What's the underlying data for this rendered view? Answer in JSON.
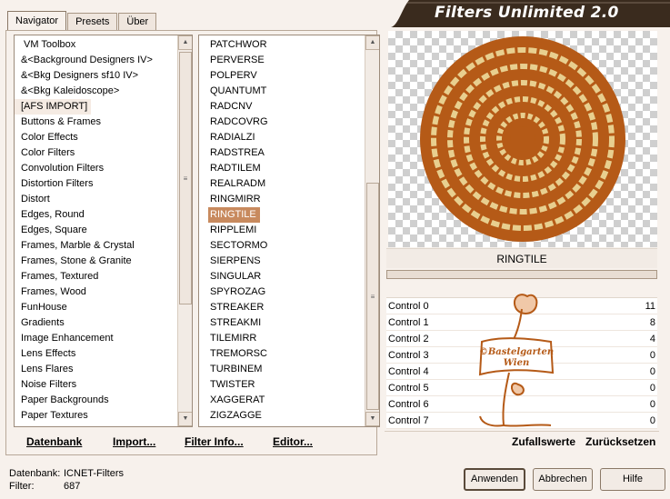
{
  "title": "Filters Unlimited 2.0",
  "tabs": [
    "Navigator",
    "Presets",
    "Über"
  ],
  "categories": [
    "VM Toolbox",
    "&<Background Designers IV>",
    "&<Bkg Designers sf10 IV>",
    "&<Bkg Kaleidoscope>",
    "[AFS IMPORT]",
    "Buttons & Frames",
    "Color Effects",
    "Color Filters",
    "Convolution Filters",
    "Distortion Filters",
    "Distort",
    "Edges, Round",
    "Edges, Square",
    "Frames, Marble & Crystal",
    "Frames, Stone & Granite",
    "Frames, Textured",
    "Frames, Wood",
    "FunHouse",
    "Gradients",
    "Image Enhancement",
    "Lens Effects",
    "Lens Flares",
    "Noise Filters",
    "Paper Backgrounds",
    "Paper Textures"
  ],
  "filters": [
    "PATCHWOR",
    "PERVERSE",
    "POLPERV",
    "QUANTUMT",
    "RADCNV",
    "RADCOVRG",
    "RADIALZI",
    "RADSTREA",
    "RADTILEM",
    "REALRADM",
    "RINGMIRR",
    "RINGTILE",
    "RIPPLEMI",
    "SECTORMO",
    "SIERPENS",
    "SINGULAR",
    "SPYROZAG",
    "STREAKER",
    "STREAKMI",
    "TILEMIRR",
    "TREMORSC",
    "TURBINEM",
    "TWISTER",
    "XAGGERAT",
    "ZIGZAGGE"
  ],
  "selected_category": "[AFS IMPORT]",
  "selected_filter": "RINGTILE",
  "left_buttons": {
    "datenbank": "Datenbank",
    "import": "Import...",
    "filter_info": "Filter Info...",
    "editor": "Editor..."
  },
  "filter_name": "RINGTILE",
  "controls": [
    {
      "label": "Control 0",
      "value": "11"
    },
    {
      "label": "Control 1",
      "value": "8"
    },
    {
      "label": "Control 2",
      "value": "4"
    },
    {
      "label": "Control 3",
      "value": "0"
    },
    {
      "label": "Control 4",
      "value": "0"
    },
    {
      "label": "Control 5",
      "value": "0"
    },
    {
      "label": "Control 6",
      "value": "0"
    },
    {
      "label": "Control 7",
      "value": "0"
    }
  ],
  "watermark_text": [
    "©Bastelgarten",
    "Wien"
  ],
  "right_actions": {
    "random": "Zufallswerte",
    "reset": "Zurücksetzen"
  },
  "status": {
    "db_label": "Datenbank:",
    "db_value": "ICNET-Filters",
    "filter_label": "Filter:",
    "filter_value": "687"
  },
  "buttons": {
    "apply": "Anwenden",
    "cancel": "Abbrechen",
    "help": "Hilfe"
  },
  "colors": {
    "ring_dark": "#b55a17",
    "ring_light": "#e8cf8f",
    "accent": "#c88a5e",
    "banner": "#3a2b1e"
  }
}
